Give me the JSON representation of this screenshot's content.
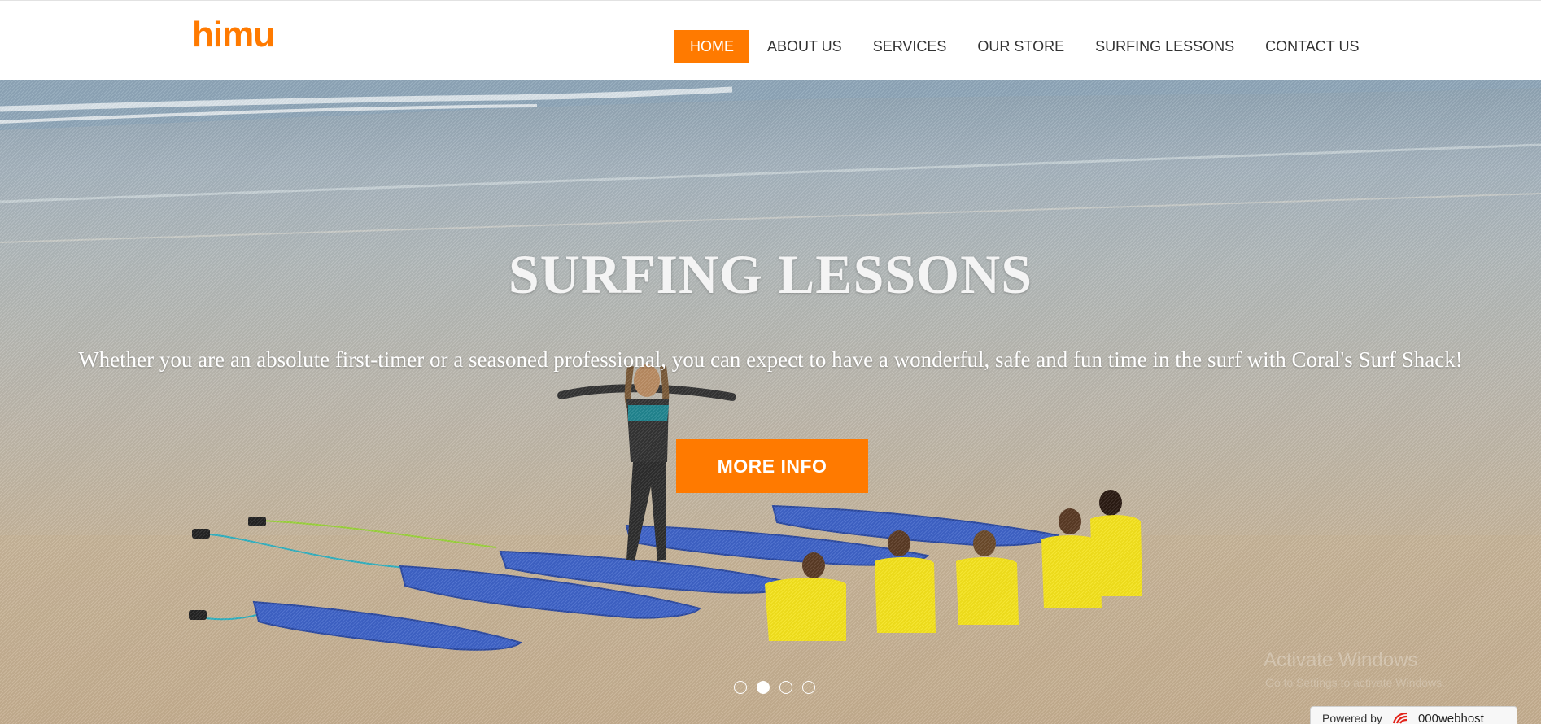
{
  "header": {
    "logo_text": "himu",
    "nav": [
      {
        "label": "HOME",
        "active": true
      },
      {
        "label": "ABOUT US",
        "active": false
      },
      {
        "label": "SERVICES",
        "active": false
      },
      {
        "label": "OUR STORE",
        "active": false
      },
      {
        "label": "SURFING LESSONS",
        "active": false
      },
      {
        "label": "CONTACT US",
        "active": false
      }
    ]
  },
  "hero": {
    "title": "SURFING LESSONS",
    "subtitle": "Whether you are an absolute first-timer or a seasoned professional, you can expect to have a wonderful, safe and fun time in the surf with Coral's Surf Shack!",
    "button_label": "MORE INFO",
    "slides_total": 4,
    "active_slide": 2
  },
  "watermark": {
    "title": "Activate Windows",
    "subtitle": "Go to Settings to activate Windows."
  },
  "badge": {
    "label": "Powered by",
    "brand": "000webhost",
    "icon": "000webhost-logo-icon"
  },
  "colors": {
    "accent": "#ff7a00",
    "nav_text": "#333333",
    "hero_text": "#ffffff"
  }
}
